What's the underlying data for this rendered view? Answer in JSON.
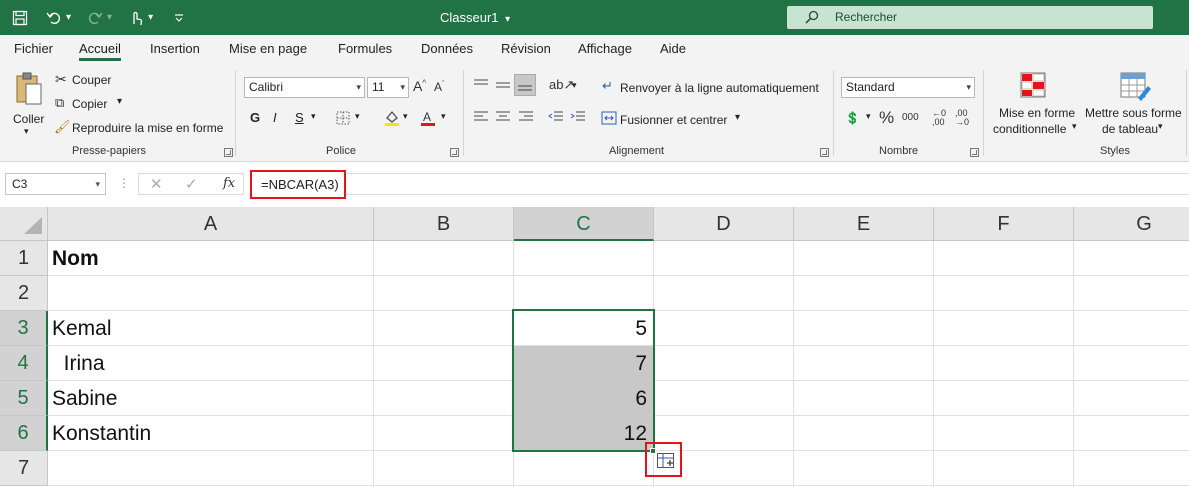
{
  "window": {
    "title": "Classeur1",
    "title_caret": "▾",
    "search_placeholder": "Rechercher"
  },
  "tabs": [
    {
      "label": "Fichier"
    },
    {
      "label": "Accueil",
      "active": true
    },
    {
      "label": "Insertion"
    },
    {
      "label": "Mise en page"
    },
    {
      "label": "Formules"
    },
    {
      "label": "Données"
    },
    {
      "label": "Révision"
    },
    {
      "label": "Affichage"
    },
    {
      "label": "Aide"
    }
  ],
  "ribbon": {
    "clipboard": {
      "paste_label": "Coller",
      "cut_label": "Couper",
      "copy_label": "Copier",
      "format_painter_label": "Reproduire la mise en forme",
      "group_label": "Presse-papiers"
    },
    "font": {
      "font_name": "Calibri",
      "font_size": "11",
      "bold": "G",
      "italic": "I",
      "underline": "S",
      "group_label": "Police"
    },
    "alignment": {
      "wrap_label": "Renvoyer à la ligne automatiquement",
      "merge_label": "Fusionner et centrer",
      "group_label": "Alignement"
    },
    "number": {
      "format": "Standard",
      "group_label": "Nombre"
    },
    "styles": {
      "conditional_label_1": "Mise en forme",
      "conditional_label_2": "conditionnelle",
      "table_label_1": "Mettre sous forme",
      "table_label_2": "de tableau",
      "group_label": "Styles"
    }
  },
  "formula_bar": {
    "name_box": "C3",
    "fx": "fx",
    "formula": "=NBCAR(A3)"
  },
  "sheet": {
    "columns": [
      "A",
      "B",
      "C",
      "D",
      "E",
      "F",
      "G"
    ],
    "rows": [
      "1",
      "2",
      "3",
      "4",
      "5",
      "6",
      "7"
    ],
    "cells": {
      "A1": "Nom",
      "A3": "Kemal",
      "A4": "  Irina",
      "A5": "Sabine",
      "A6": "Konstantin",
      "C3": "5",
      "C4": "7",
      "C5": "6",
      "C6": "12"
    },
    "selection": "C3:C6",
    "accent_color": "#217346",
    "highlight_color": "#e4141b"
  }
}
